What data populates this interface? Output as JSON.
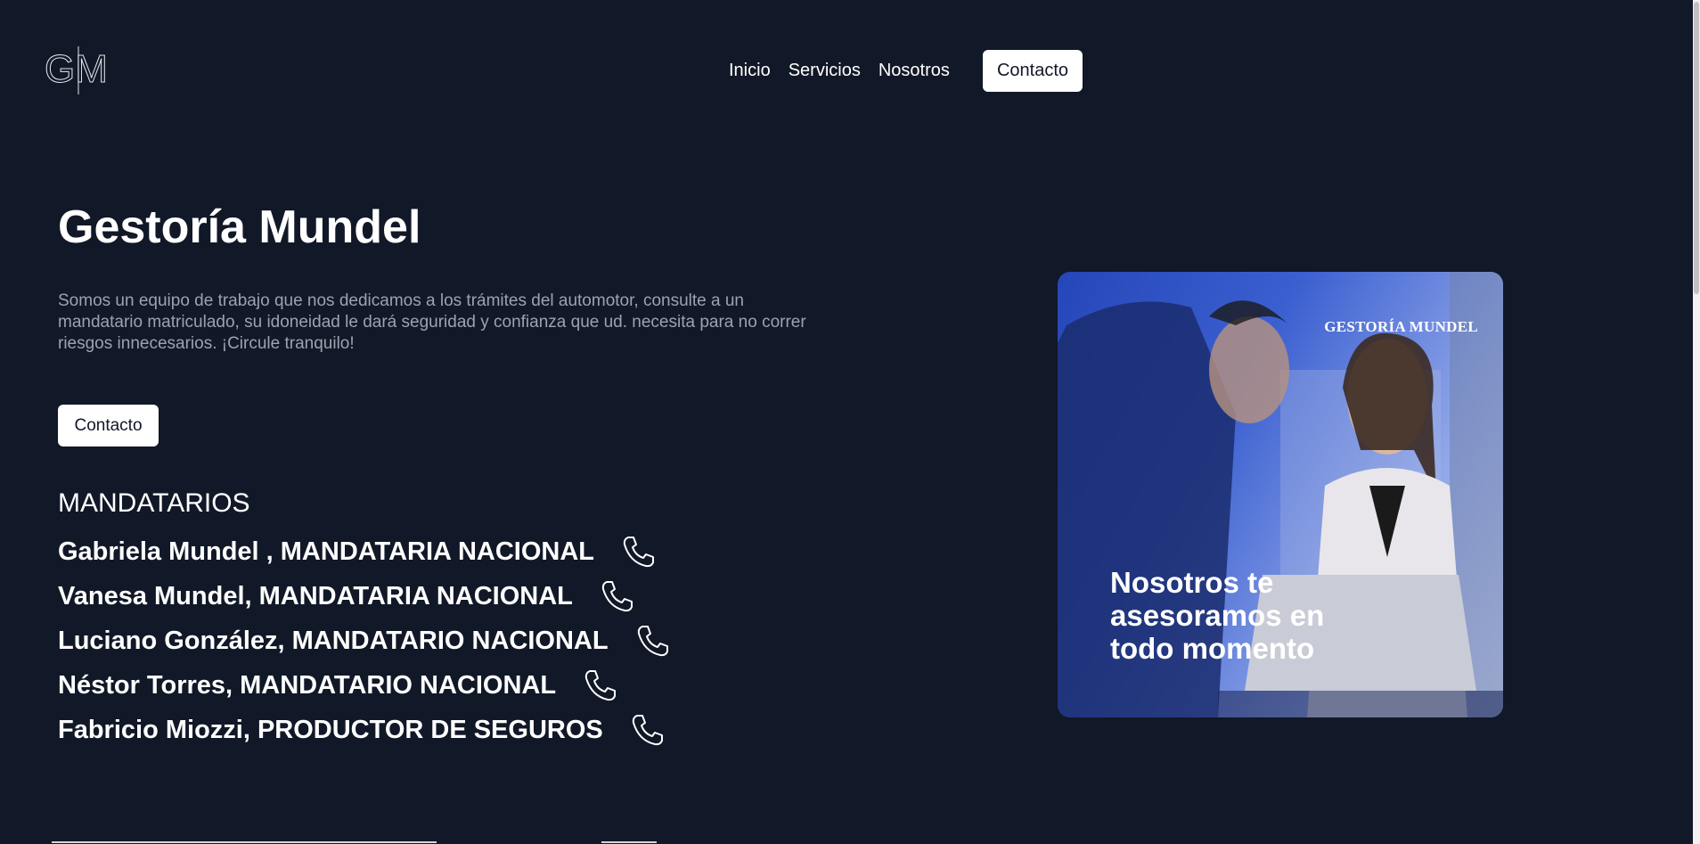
{
  "nav": {
    "logo_text": "GM",
    "links": [
      "Inicio",
      "Servicios",
      "Nosotros"
    ],
    "contact_label": "Contacto"
  },
  "hero": {
    "title": "Gestoría Mundel",
    "description": "Somos un equipo de trabajo que nos dedicamos a los trámites del automotor, consulte a un mandatario matriculado, su idoneidad le dará seguridad y confianza que ud. necesita para no correr riesgos innecesarios. ¡Circule tranquilo!",
    "contact_label": "Contacto"
  },
  "mandatarios": {
    "heading": "MANDATARIOS",
    "items": [
      "Gabriela Mundel , MANDATARIA NACIONAL",
      "Vanesa Mundel, MANDATARIA NACIONAL",
      "Luciano González, MANDATARIO NACIONAL",
      "Néstor Torres, MANDATARIO NACIONAL",
      "Fabricio Miozzi, PRODUCTOR DE SEGUROS"
    ]
  },
  "promo": {
    "brand": "GESTORÍA MUNDEL",
    "tagline_lines": [
      "Nosotros te",
      "asesoramos en",
      "todo momento"
    ]
  },
  "colors": {
    "background": "#111827",
    "button_bg": "#ffffff",
    "text_muted": "#9ca3af"
  },
  "icons": {
    "phone": "phone-icon"
  }
}
